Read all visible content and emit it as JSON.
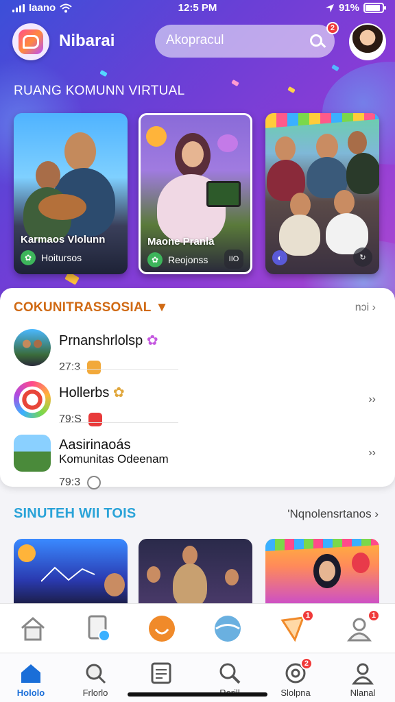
{
  "status_bar": {
    "carrier": "Iaano",
    "time": "12:5 PM",
    "battery": "91%"
  },
  "header": {
    "app_name": "Nibarai",
    "search_placeholder": "Akopracul",
    "search_badge": "2"
  },
  "hero": {
    "section_title": "RUANG KOMUNN VIRTUAL",
    "cards": [
      {
        "title": "Karmaos Vlolunn",
        "subtitle": "Hoitursos",
        "corner": ""
      },
      {
        "title": "Maone Pranla",
        "subtitle": "Reojonss",
        "corner": "IIO"
      },
      {
        "title": "",
        "subtitle": "",
        "corner": ""
      }
    ]
  },
  "community_panel": {
    "title": "COKUNITRASSOSIAL",
    "more_label": "nɔi",
    "items": [
      {
        "name": "Prnanshrlolsp",
        "name2": "",
        "count": "27:3"
      },
      {
        "name": "Hollerbs",
        "name2": "",
        "count": "79:S"
      },
      {
        "name": "Aasirinaoás",
        "name2": "Komunitas Odeenam",
        "count": "79:3"
      }
    ]
  },
  "section2": {
    "title": "SINUTEH WII TOIS",
    "more_label": "'Nqnolensrtanos"
  },
  "tab_bar": {
    "tabs": [
      {
        "label": "Hololo"
      },
      {
        "label": "Frlorlo"
      },
      {
        "label": ""
      },
      {
        "label": "Rorill"
      },
      {
        "label": "Slolpna"
      },
      {
        "label": "Nlanal"
      }
    ],
    "badges": {
      "slolpna": "2"
    }
  },
  "action_bar": {
    "badges": {
      "share": "1",
      "profile": "1"
    }
  },
  "colors": {
    "accent": "#7b3fe4",
    "panel_title": "#d06a14",
    "section2_title": "#2aa3d8",
    "active_tab": "#1a6ed8",
    "badge": "#f03a3a"
  }
}
